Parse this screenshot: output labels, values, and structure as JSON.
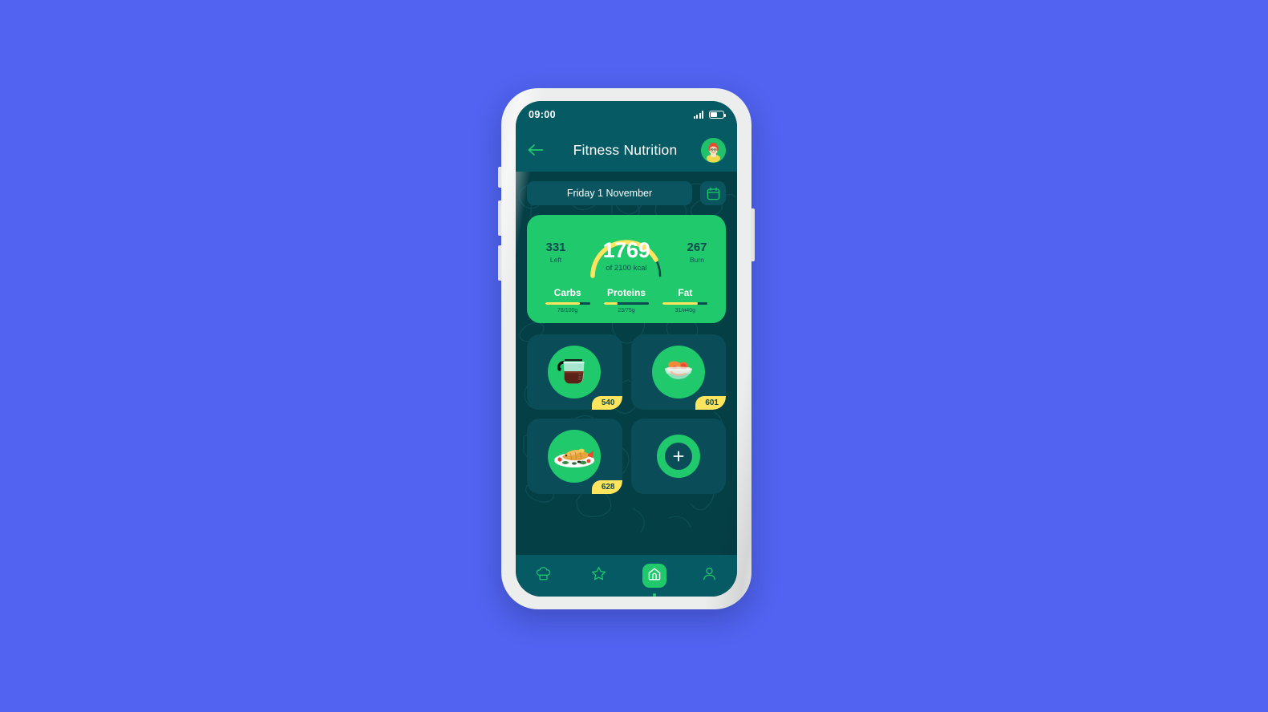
{
  "theme": {
    "page_bg": "#5163f0",
    "screen_dark": "#053f46",
    "bar_teal": "#065a63",
    "card_green": "#21c96d",
    "accent_yellow": "#ffe45e",
    "deep_teal_text": "#0d4a4f",
    "tile_teal": "#0a4d58"
  },
  "status_bar": {
    "time": "09:00",
    "signal_icon": "signal-bars-icon",
    "battery_icon": "battery-icon",
    "battery_level_percent": 52
  },
  "app_bar": {
    "back_icon": "arrow-left-icon",
    "title": "Fitness  Nutrition",
    "avatar_icon": "user-avatar"
  },
  "date_selector": {
    "label": "Friday 1 November",
    "calendar_icon": "calendar-icon"
  },
  "calorie_card": {
    "consumed": "1769",
    "goal_text": "of 2100 kcal",
    "left": {
      "value": "331",
      "label": "Left"
    },
    "burn": {
      "value": "267",
      "label": "Burn"
    },
    "gauge_percent": 84,
    "macros": [
      {
        "name": "Carbs",
        "value_text": "78/100g",
        "percent": 78
      },
      {
        "name": "Proteins",
        "value_text": "23/75g",
        "percent": 31
      },
      {
        "name": "Fat",
        "value_text": "31/и40g",
        "percent": 78
      }
    ]
  },
  "food_grid": [
    {
      "name": "coffee-pot",
      "icon": "coffee-pot-icon",
      "calories": "540"
    },
    {
      "name": "fruit-bowl",
      "icon": "fruit-bowl-icon",
      "calories": "601"
    },
    {
      "name": "fish-plate",
      "icon": "fish-plate-icon",
      "calories": "628"
    },
    {
      "name": "add-meal",
      "icon": "plus-icon",
      "calories": ""
    }
  ],
  "bottom_nav": [
    {
      "name": "recipes",
      "icon": "chef-hat-icon",
      "active": false
    },
    {
      "name": "favorites",
      "icon": "star-icon",
      "active": false
    },
    {
      "name": "home",
      "icon": "home-icon",
      "active": true
    },
    {
      "name": "profile",
      "icon": "person-icon",
      "active": false
    }
  ]
}
